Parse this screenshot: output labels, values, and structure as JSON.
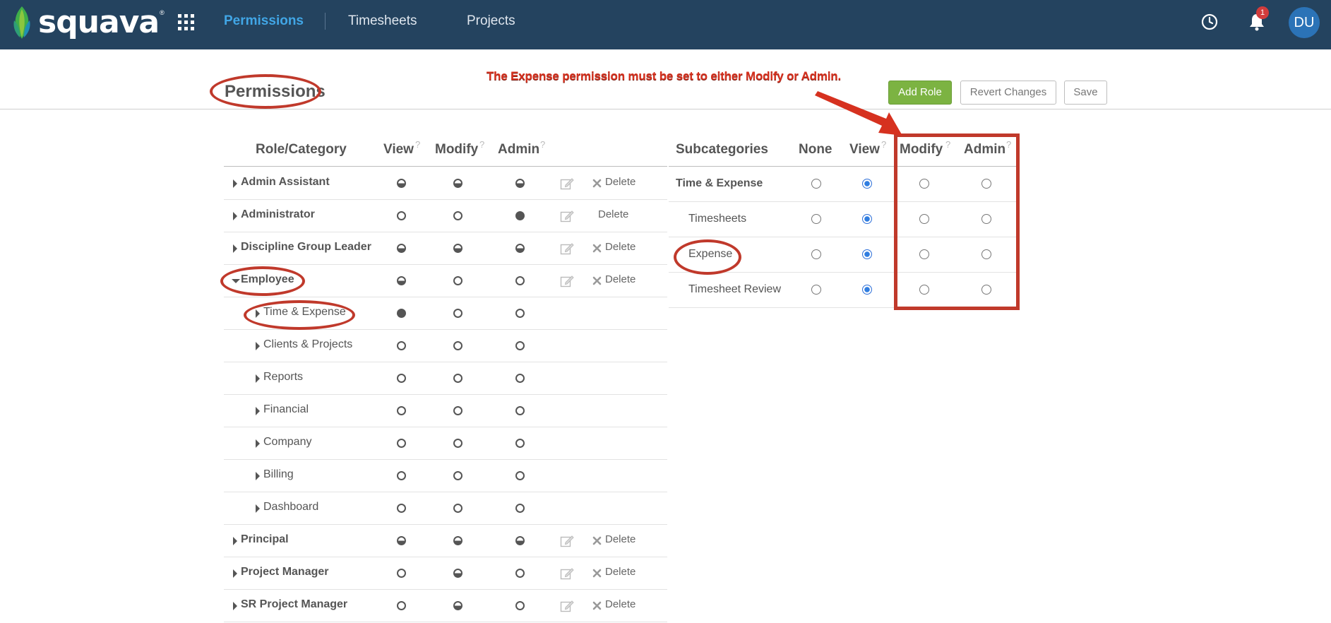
{
  "nav": {
    "brand": "squava",
    "brand_mark": "®",
    "items": [
      {
        "label": "Permissions",
        "active": true
      },
      {
        "label": "Timesheets",
        "active": false
      },
      {
        "label": "Projects",
        "active": false
      }
    ],
    "notification_count": "1",
    "avatar_initials": "DU",
    "icons": [
      "apps-grid-icon",
      "clock-icon",
      "bell-icon"
    ],
    "colors": {
      "bar": "#24435f",
      "active": "#41a6e6",
      "badge": "#d23c3c",
      "avatar": "#2b73b7"
    }
  },
  "header": {
    "title": "Permissions",
    "instruction": "The Expense permission must be set to either Modify or Admin.",
    "buttons": {
      "add_role": "Add Role",
      "revert": "Revert Changes",
      "save": "Save"
    },
    "colors": {
      "add_role": "#7cb342",
      "annotation": "#c0392b"
    }
  },
  "roles_table": {
    "headers": {
      "role": "Role/Category",
      "view": "View",
      "modify": "Modify",
      "admin": "Admin",
      "help": "?"
    },
    "delete_label": "Delete",
    "rows": [
      {
        "label": "Admin Assistant",
        "level": "role",
        "expanded": false,
        "view": "half",
        "modify": "half",
        "admin": "half",
        "editable": true,
        "delete_icon": true
      },
      {
        "label": "Administrator",
        "level": "role",
        "expanded": false,
        "view": "empty",
        "modify": "empty",
        "admin": "full",
        "editable": true,
        "delete_icon": false
      },
      {
        "label": "Discipline Group Leader",
        "level": "role",
        "expanded": false,
        "view": "half",
        "modify": "half",
        "admin": "half",
        "editable": true,
        "delete_icon": true
      },
      {
        "label": "Employee",
        "level": "role",
        "expanded": true,
        "view": "half",
        "modify": "empty",
        "admin": "empty",
        "editable": true,
        "delete_icon": true
      },
      {
        "label": "Time & Expense",
        "level": "category",
        "view": "full",
        "modify": "empty",
        "admin": "empty"
      },
      {
        "label": "Clients & Projects",
        "level": "category",
        "view": "empty",
        "modify": "empty",
        "admin": "empty"
      },
      {
        "label": "Reports",
        "level": "category",
        "view": "empty",
        "modify": "empty",
        "admin": "empty"
      },
      {
        "label": "Financial",
        "level": "category",
        "view": "empty",
        "modify": "empty",
        "admin": "empty"
      },
      {
        "label": "Company",
        "level": "category",
        "view": "empty",
        "modify": "empty",
        "admin": "empty"
      },
      {
        "label": "Billing",
        "level": "category",
        "view": "empty",
        "modify": "empty",
        "admin": "empty"
      },
      {
        "label": "Dashboard",
        "level": "category",
        "view": "empty",
        "modify": "empty",
        "admin": "empty"
      },
      {
        "label": "Principal",
        "level": "role",
        "expanded": false,
        "view": "half",
        "modify": "half",
        "admin": "half",
        "editable": true,
        "delete_icon": true
      },
      {
        "label": "Project Manager",
        "level": "role",
        "expanded": false,
        "view": "empty",
        "modify": "half",
        "admin": "empty",
        "editable": true,
        "delete_icon": true
      },
      {
        "label": "SR Project Manager",
        "level": "role",
        "expanded": false,
        "view": "empty",
        "modify": "half",
        "admin": "empty",
        "editable": true,
        "delete_icon": true
      }
    ]
  },
  "subcategories_table": {
    "headers": {
      "name": "Subcategories",
      "none": "None",
      "view": "View",
      "modify": "Modify",
      "admin": "Admin",
      "help": "?"
    },
    "rows": [
      {
        "label": "Time & Expense",
        "is_category": true,
        "selected": "view"
      },
      {
        "label": "Timesheets",
        "is_category": false,
        "selected": "view"
      },
      {
        "label": "Expense",
        "is_category": false,
        "selected": "view"
      },
      {
        "label": "Timesheet Review",
        "is_category": false,
        "selected": "view"
      }
    ]
  }
}
